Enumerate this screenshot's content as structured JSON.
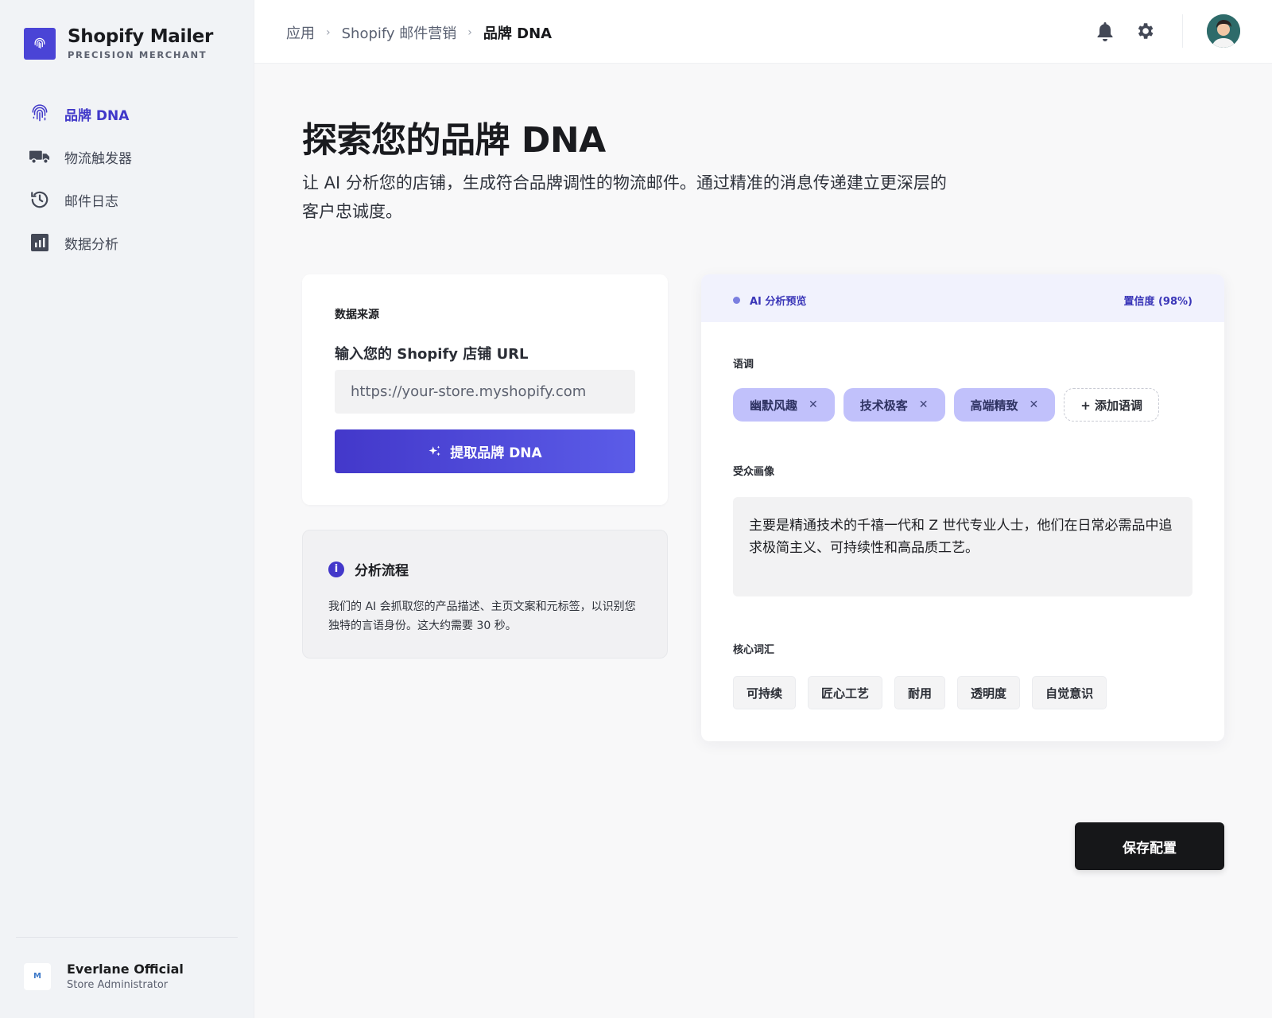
{
  "sidebar": {
    "brand_name": "Shopify Mailer",
    "brand_sub": "PRECISION MERCHANT",
    "items": [
      {
        "label": "品牌 DNA",
        "icon": "fingerprint-icon",
        "active": true
      },
      {
        "label": "物流触发器",
        "icon": "truck-icon",
        "active": false
      },
      {
        "label": "邮件日志",
        "icon": "history-icon",
        "active": false
      },
      {
        "label": "数据分析",
        "icon": "analytics-icon",
        "active": false
      }
    ],
    "store_name": "Everlane Official",
    "store_role": "Store Administrator",
    "store_logo": "M"
  },
  "header": {
    "breadcrumbs": [
      "应用",
      "Shopify 邮件营销",
      "品牌 DNA"
    ],
    "icons": [
      "bell-icon",
      "gear-icon",
      "avatar"
    ]
  },
  "main": {
    "title": "探索您的品牌 DNA",
    "description": "让 AI 分析您的店铺，生成符合品牌调性的物流邮件。通过精准的消息传递建立更深层的客户忠诚度。"
  },
  "source_card": {
    "label": "数据来源",
    "field_label": "输入您的 Shopify 店铺 URL",
    "url_value": "",
    "url_placeholder": "https://your-store.myshopify.com",
    "button_label": "提取品牌 DNA"
  },
  "info_box": {
    "title": "分析流程",
    "text": "我们的 AI 会抓取您的产品描述、主页文案和元标签，以识别您独特的言语身份。这大约需要 30 秒。"
  },
  "preview": {
    "header_label": "AI 分析预览",
    "confidence": "置信度 (98%)",
    "tone_label": "语调",
    "tones": [
      "幽默风趣",
      "技术极客",
      "高端精致"
    ],
    "add_tone": "+ 添加语调",
    "audience_label": "受众画像",
    "audience_text": "主要是精通技术的千禧一代和 Z 世代专业人士，他们在日常必需品中追求极简主义、可持续性和高品质工艺。",
    "keywords_label": "核心词汇",
    "keywords": [
      "可持续",
      "匠心工艺",
      "耐用",
      "透明度",
      "自觉意识"
    ]
  },
  "save_button": "保存配置",
  "colors": {
    "accent": "#4338ca",
    "chip": "#c1c1fb",
    "sidebar_bg": "#f1f3f6",
    "dark_button": "#161719"
  }
}
